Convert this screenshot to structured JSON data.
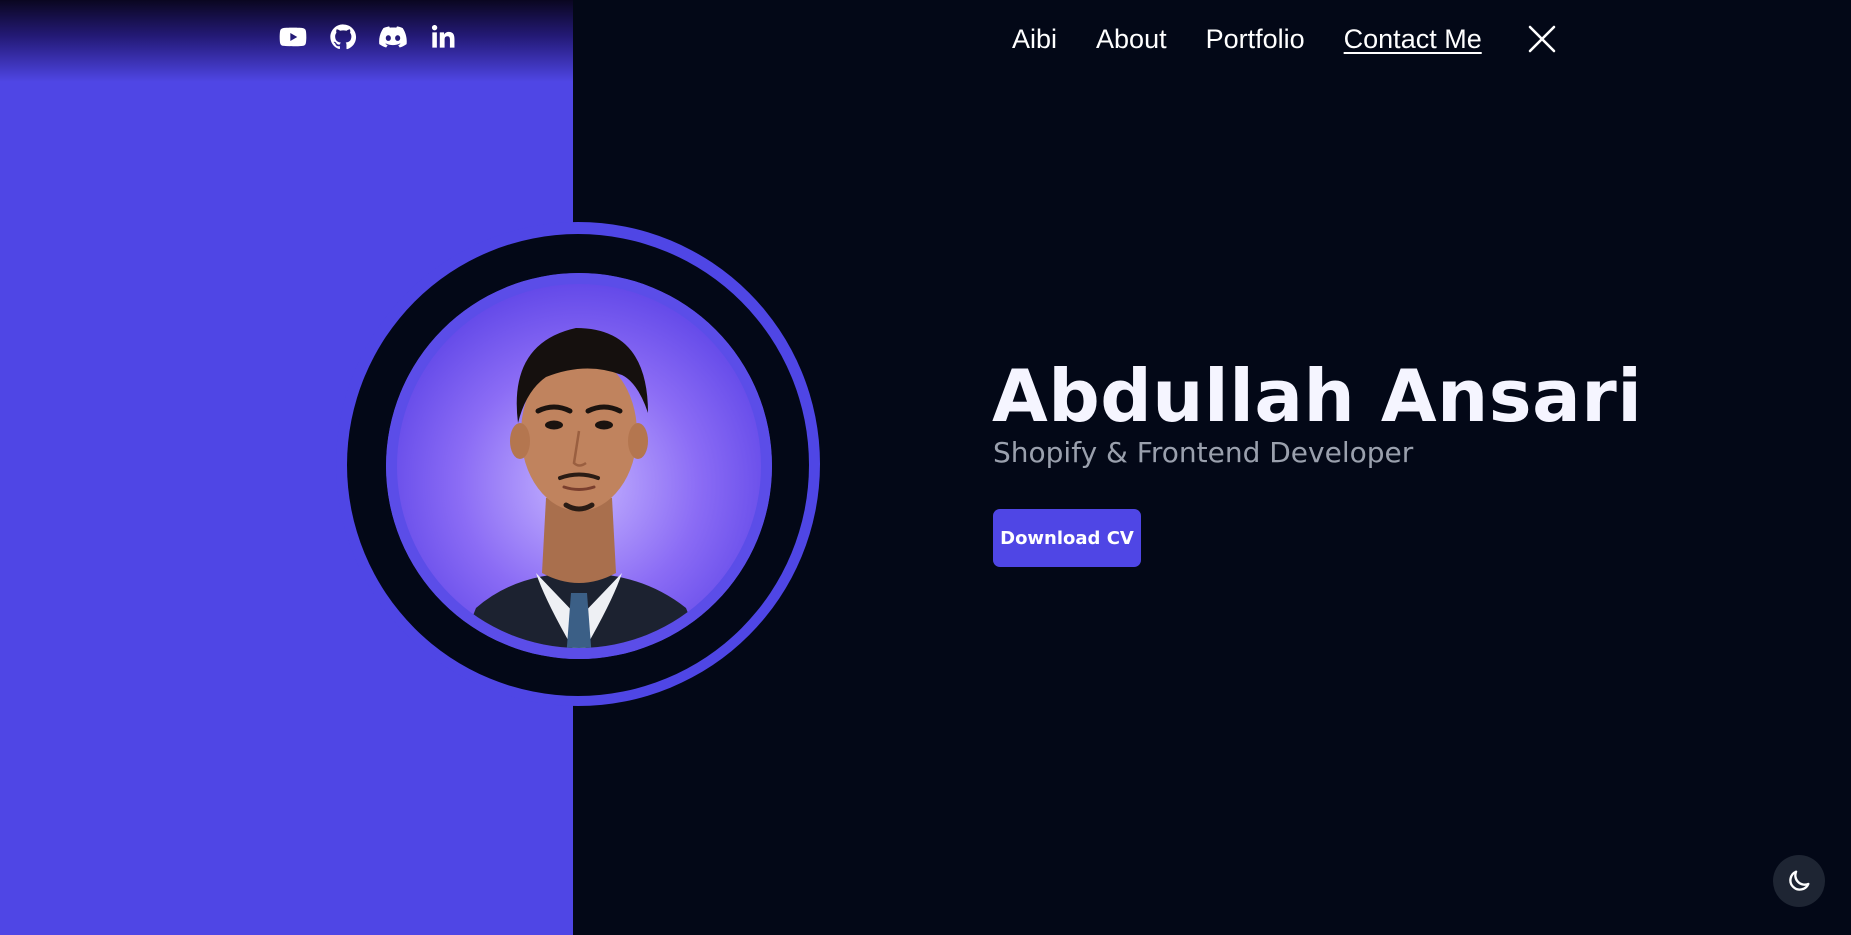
{
  "colors": {
    "accent": "#4f46e5",
    "background": "#030817",
    "text": "#ffffff",
    "subtitle": "#9aa0ad"
  },
  "socials": [
    {
      "icon": "youtube-icon"
    },
    {
      "icon": "github-icon"
    },
    {
      "icon": "discord-icon"
    },
    {
      "icon": "linkedin-icon"
    }
  ],
  "nav": {
    "items": [
      "Aibi",
      "About",
      "Portfolio",
      "Contact Me"
    ],
    "active": "Contact Me",
    "close_icon": "close-icon"
  },
  "hero": {
    "name": "Abdullah Ansari",
    "role": "Shopify & Frontend Developer",
    "cta_label": "Download CV"
  },
  "theme_toggle": {
    "icon": "moon-icon"
  }
}
